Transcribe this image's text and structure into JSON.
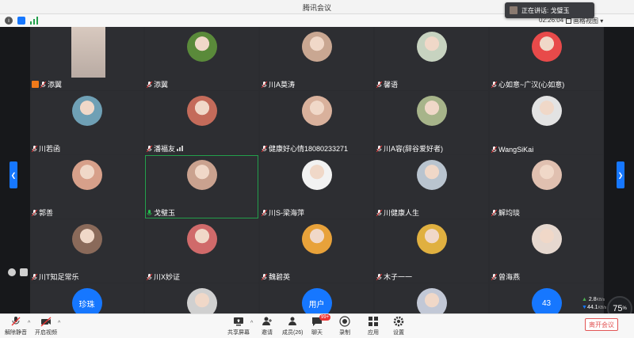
{
  "window": {
    "title": "腾讯会议"
  },
  "speaking": {
    "label": "正在讲话: 戈璧玉"
  },
  "meeting": {
    "timer": "02:26:04",
    "view_mode": "画格视图"
  },
  "participants": [
    {
      "name": "添翼",
      "kind": "video",
      "avatar_color": "#d8c9bf",
      "host": true
    },
    {
      "name": "添翼",
      "kind": "photo",
      "avatar_color": "#5a8a3a"
    },
    {
      "name": "川A莫涛",
      "kind": "photo",
      "avatar_color": "#c9a792"
    },
    {
      "name": "馨语",
      "kind": "photo",
      "avatar_color": "#c7d3c0"
    },
    {
      "name": "心如意~广汉(心如意)",
      "kind": "photo",
      "avatar_color": "#e84a4a"
    },
    {
      "name": "川若函",
      "kind": "photo",
      "avatar_color": "#6fa0b5"
    },
    {
      "name": "潘福友",
      "kind": "photo",
      "avatar_color": "#c46b5a",
      "signal": true
    },
    {
      "name": "健康好心情18080233271",
      "kind": "photo",
      "avatar_color": "#d9b19c"
    },
    {
      "name": "川A容(辞谷爱好者)",
      "kind": "photo",
      "avatar_color": "#a7b48a"
    },
    {
      "name": "WangSiKai",
      "kind": "photo",
      "avatar_color": "#e3e3e3"
    },
    {
      "name": "郭善",
      "kind": "photo",
      "avatar_color": "#d7a08a"
    },
    {
      "name": "戈璧玉",
      "kind": "photo",
      "avatar_color": "#caa28f",
      "active": true
    },
    {
      "name": "川S-梁海萍",
      "kind": "photo",
      "avatar_color": "#f2f2f2"
    },
    {
      "name": "川健康人生",
      "kind": "photo",
      "avatar_color": "#b9c4cf"
    },
    {
      "name": "解均琰",
      "kind": "photo",
      "avatar_color": "#e0c0b0"
    },
    {
      "name": "川T知足常乐",
      "kind": "photo",
      "avatar_color": "#8a6a5a"
    },
    {
      "name": "川X妙证",
      "kind": "photo",
      "avatar_color": "#d06a6a"
    },
    {
      "name": "魏碧英",
      "kind": "photo",
      "avatar_color": "#e8a23a"
    },
    {
      "name": "木子一一",
      "kind": "photo",
      "avatar_color": "#e0b040"
    },
    {
      "name": "曾海燕",
      "kind": "photo",
      "avatar_color": "#e6d8cf"
    },
    {
      "name": "珍珠",
      "kind": "text",
      "avatar_color": "#1677ff",
      "text": "珍珠"
    },
    {
      "name": "",
      "kind": "photo",
      "avatar_color": "#d0d0d0"
    },
    {
      "name": "用户",
      "kind": "text",
      "avatar_color": "#1677ff",
      "text": "用户"
    },
    {
      "name": "",
      "kind": "photo",
      "avatar_color": "#c2c8d6"
    },
    {
      "name": "43",
      "kind": "text",
      "avatar_color": "#1677ff",
      "text": "43"
    }
  ],
  "network": {
    "up": "2.8",
    "down": "44.1",
    "unit": "KB/s",
    "cpu": "75",
    "cpu_unit": "%"
  },
  "toolbar": {
    "unmute": "解除静音",
    "start_video": "开启视频",
    "share_screen": "共享屏幕",
    "invite": "邀请",
    "members": "成员(26)",
    "chat": "聊天",
    "chat_badge": "99+",
    "record": "录制",
    "apps": "应用",
    "settings": "设置",
    "leave": "离开会议"
  },
  "colors": {
    "accent": "#1677ff",
    "active_border": "#23a04c",
    "leave": "#e25555"
  }
}
